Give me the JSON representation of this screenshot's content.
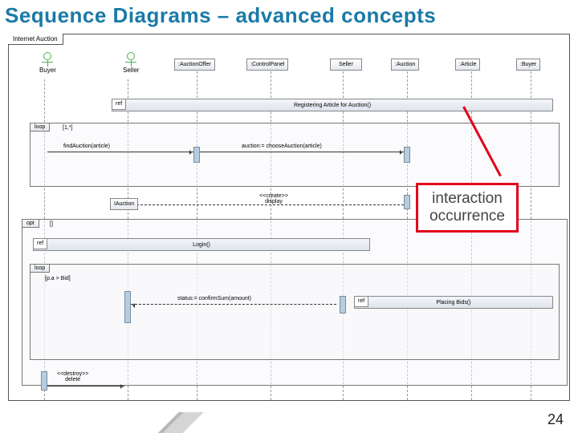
{
  "title": "Sequence Diagrams – advanced concepts",
  "frame": "Internet Auction",
  "actors": {
    "buyer": "Buyer",
    "seller": "Seller"
  },
  "lifelines": {
    "auctionOffer": ":AuctionOffer",
    "controlPanel": ":ControlPanel",
    "sellerStr": "Seller",
    "auction": ":Auction",
    "article": ":Article",
    "buyerStr": ":Buyer"
  },
  "frags": {
    "ref1": "Registering Article for Auction()",
    "loop1": "loop",
    "loop1guard": "[1,*]",
    "opt": "opt",
    "optguard": "[]",
    "refLogin": "Login()",
    "loop2": "loop",
    "loop2guard": "[p.a > Bid]",
    "refBids": "Placing Bids()",
    "refTag": "ref"
  },
  "msgs": {
    "findAuction": "findAuction(article)",
    "choose": "auction:= chooseAuction(article)",
    "createDisplay": "<<create>>\ndisplay",
    "iauction": "IAuction",
    "confirm": "status:= confirmSum(amount)",
    "destroyDelete": "<<destroy>>\ndelete"
  },
  "callout": "interaction occurrence",
  "page": "24"
}
